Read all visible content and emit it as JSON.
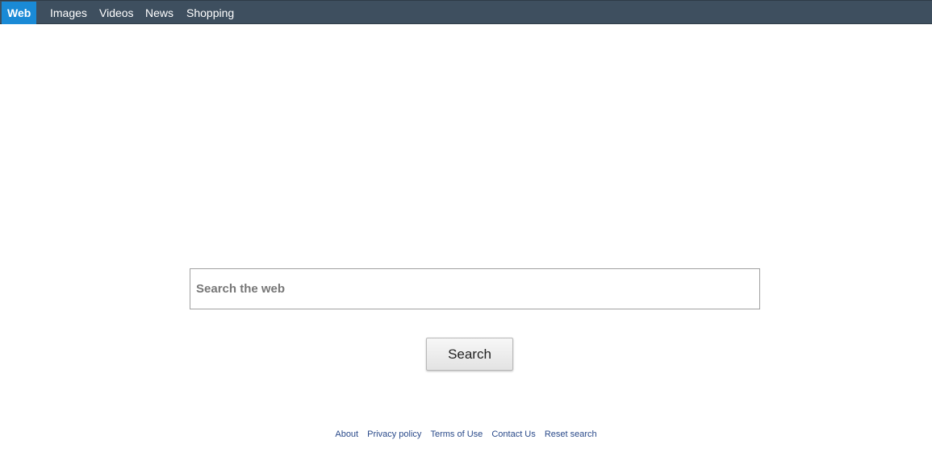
{
  "nav": {
    "items": [
      {
        "label": "Web",
        "active": true
      },
      {
        "label": "Images",
        "active": false
      },
      {
        "label": "Videos",
        "active": false
      },
      {
        "label": "News",
        "active": false
      },
      {
        "label": "Shopping",
        "active": false
      }
    ]
  },
  "search": {
    "placeholder": "Search the web",
    "value": "",
    "button_label": "Search"
  },
  "footer": {
    "links": [
      "About",
      "Privacy policy",
      "Terms of Use",
      "Contact Us",
      "Reset search"
    ]
  },
  "colors": {
    "topbar": "#3e4f5f",
    "active_tab": "#1a8ad6",
    "footer_link": "#2a4a8a"
  }
}
